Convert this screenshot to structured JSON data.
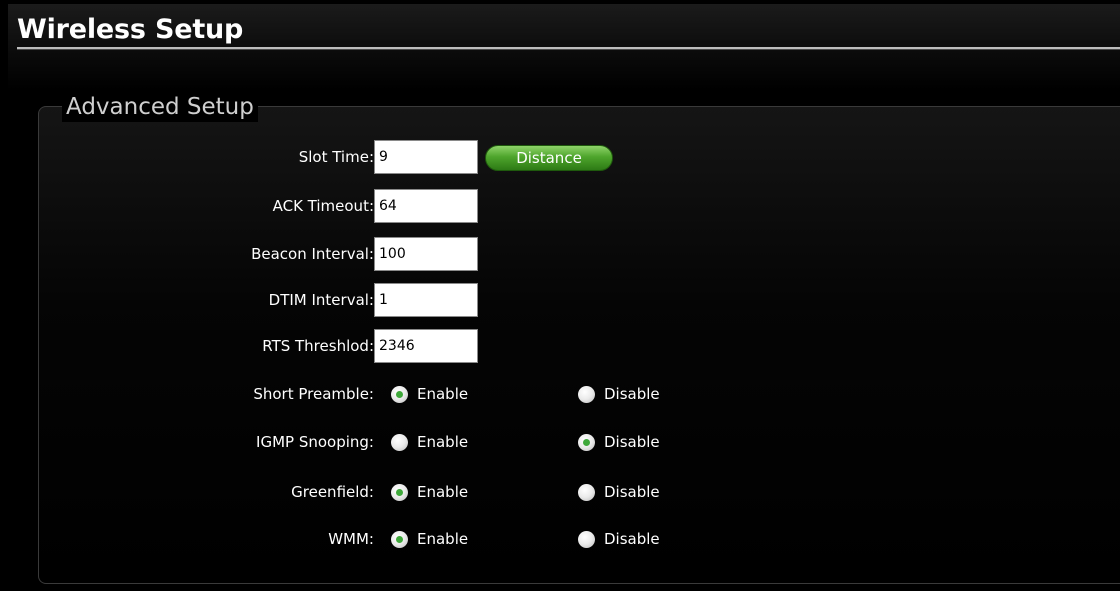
{
  "page": {
    "title": "Wireless Setup"
  },
  "section": {
    "legend": "Advanced Setup"
  },
  "fields": {
    "slot_time": {
      "label": "Slot Time:",
      "value": "9"
    },
    "distance_button": "Distance",
    "ack_timeout": {
      "label": "ACK Timeout:",
      "value": "64"
    },
    "beacon_interval": {
      "label": "Beacon Interval:",
      "value": "100"
    },
    "dtim_interval": {
      "label": "DTIM Interval:",
      "value": "1"
    },
    "rts_threshold": {
      "label": "RTS Threshlod:",
      "value": "2346"
    }
  },
  "options": {
    "enable_label": "Enable",
    "disable_label": "Disable",
    "short_preamble": {
      "label": "Short Preamble:",
      "selected": "Enable"
    },
    "igmp_snooping": {
      "label": "IGMP Snooping:",
      "selected": "Disable"
    },
    "greenfield": {
      "label": "Greenfield:",
      "selected": "Enable"
    },
    "wmm": {
      "label": "WMM:",
      "selected": "Enable"
    }
  },
  "colors": {
    "background": "#000000",
    "button_green": "#4ea52c",
    "radio_selected": "#3ea83a"
  }
}
